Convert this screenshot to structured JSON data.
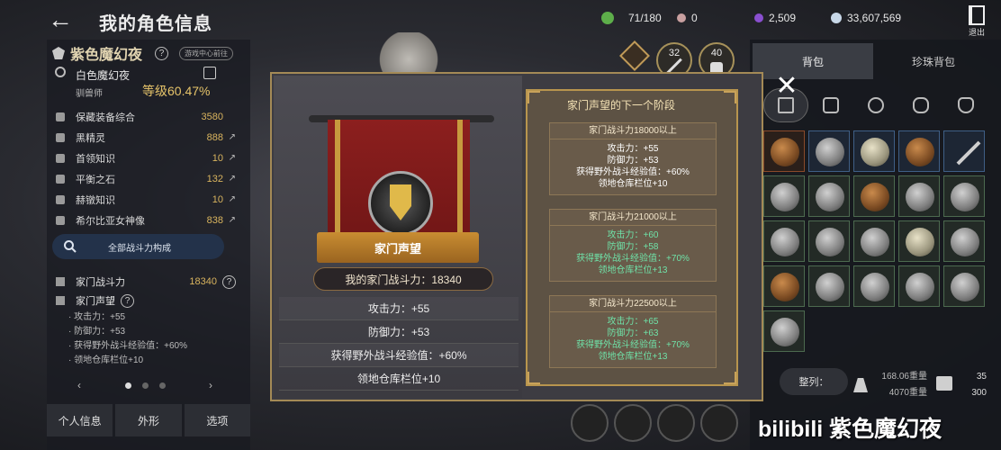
{
  "header": {
    "back_glyph": "←",
    "title": "我的角色信息",
    "resources": [
      {
        "icon": "energy-icon",
        "value": "71/180",
        "color": "#5dae4a"
      },
      {
        "icon": "pearl-icon",
        "value": "0",
        "color": "#c9a0a0"
      },
      {
        "icon": "crystal-icon",
        "value": "2,509",
        "color": "#8a4fd0"
      },
      {
        "icon": "silver-icon",
        "value": "33,607,569",
        "color": "#c8d8e8"
      }
    ],
    "exit_label": "退出"
  },
  "profile": {
    "family_name": "紫色魔幻夜",
    "help": "?",
    "tag": "游戏中心前往",
    "char_name": "白色魔幻夜",
    "char_class": "驯兽师",
    "level": "等级60.47%"
  },
  "stats": [
    {
      "name": "保藏装备综合",
      "value": "3580",
      "link": ""
    },
    {
      "name": "黑精灵",
      "value": "888",
      "link": "↗"
    },
    {
      "name": "首领知识",
      "value": "10",
      "link": "↗"
    },
    {
      "name": "平衡之石",
      "value": "132",
      "link": "↗"
    },
    {
      "name": "赫镦知识",
      "value": "10",
      "link": "↗"
    },
    {
      "name": "希尔比亚女神像",
      "value": "838",
      "link": "↗"
    }
  ],
  "combat_button": "全部战斗力构成",
  "family_power": {
    "label": "家门战斗力",
    "value": "18340",
    "help": "?"
  },
  "family_reputation": {
    "label": "家门声望",
    "help": "?",
    "bonuses": [
      "· 攻击力：+55",
      "· 防御力：+53",
      "· 获得野外战斗经验值：+60%",
      "· 领地仓库栏位+10"
    ]
  },
  "pager": {
    "prev": "‹",
    "next": "›"
  },
  "bottom_tabs": [
    "个人信息",
    "外形",
    "选项"
  ],
  "badges": {
    "b1": "32",
    "b2": "40"
  },
  "inventory": {
    "tabs": [
      "背包",
      "珍珠背包"
    ],
    "close": "✕",
    "sort": "整列：",
    "weight": [
      "168.06重量",
      "4070重量"
    ],
    "slots": [
      "35",
      "300"
    ]
  },
  "modal": {
    "banner_label": "家门声望",
    "power_text": "我的家门战斗力：18340",
    "stats": [
      "攻击力：+55",
      "防御力：+53",
      "获得野外战斗经验值：+60%",
      "领地仓库栏位+10"
    ],
    "next_title": "家门声望的下一个阶段",
    "tiers": [
      {
        "title": "家门战斗力18000以上",
        "lines": [
          "攻击力：+55",
          "防御力：+53",
          "获得野外战斗经验值：+60%",
          "领地仓库栏位+10"
        ],
        "color": "#ffffff"
      },
      {
        "title": "家门战斗力21000以上",
        "lines": [
          "攻击力：+60",
          "防御力：+58",
          "获得野外战斗经验值：+70%",
          "领地仓库栏位+13"
        ],
        "color": "#6fe2a8"
      },
      {
        "title": "家门战斗力22500以上",
        "lines": [
          "攻击力：+65",
          "防御力：+63",
          "获得野外战斗经验值：+70%",
          "领地仓库栏位+13"
        ],
        "color": "#6fe2a8"
      }
    ]
  },
  "watermark": "bilibili 紫色魔幻夜"
}
